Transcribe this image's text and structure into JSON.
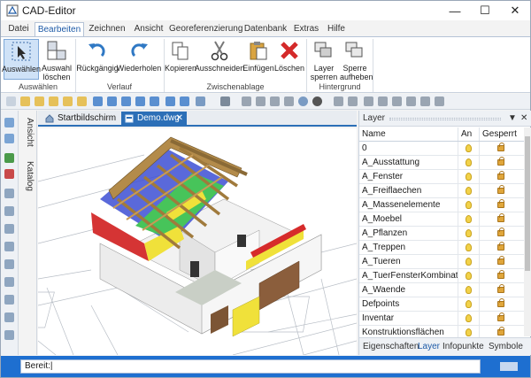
{
  "window": {
    "title": "CAD-Editor",
    "controls": {
      "minimize": "—",
      "maximize": "☐",
      "close": "✕"
    }
  },
  "ribbon_tabs": [
    "Datei",
    "Bearbeiten",
    "Zeichnen",
    "Ansicht",
    "Georeferenzierung",
    "Datenbank",
    "Extras",
    "Hilfe"
  ],
  "active_ribbon_tab": "Bearbeiten",
  "ribbon": {
    "groups": [
      {
        "label": "Auswählen",
        "buttons": [
          {
            "label": "Auswählen",
            "icon": "select-cursor-icon"
          },
          {
            "label": "Auswahl löschen",
            "icon": "clear-selection-icon"
          }
        ]
      },
      {
        "label": "Verlauf",
        "buttons": [
          {
            "label": "Rückgängig",
            "icon": "undo-icon"
          },
          {
            "label": "Wiederholen",
            "icon": "redo-icon"
          }
        ]
      },
      {
        "label": "Zwischenablage",
        "buttons": [
          {
            "label": "Kopieren",
            "icon": "copy-icon"
          },
          {
            "label": "Ausschneiden",
            "icon": "scissors-icon"
          },
          {
            "label": "Einfügen",
            "icon": "paste-icon"
          },
          {
            "label": "Löschen",
            "icon": "delete-icon"
          }
        ]
      },
      {
        "label": "Hintergrund",
        "buttons": [
          {
            "label": "Layer sperren",
            "icon": "layer-lock-icon"
          },
          {
            "label": "Sperre aufheben",
            "icon": "layer-unlock-icon"
          }
        ]
      }
    ]
  },
  "side_tabs": [
    "Ansicht",
    "Katalog"
  ],
  "document_tabs": [
    {
      "label": "Startbildschirm",
      "icon": "home-icon"
    },
    {
      "label": "Demo.dwg",
      "icon": "dwg-file-icon",
      "close": "✕"
    }
  ],
  "layer_panel": {
    "title": "Layer",
    "pin": "▼",
    "close": "✕",
    "columns": [
      "Name",
      "An",
      "Gesperrt"
    ],
    "rows": [
      "0",
      "A_Ausstattung",
      "A_Fenster",
      "A_Freiflaechen",
      "A_Massenelemente",
      "A_Moebel",
      "A_Pflanzen",
      "A_Treppen",
      "A_Tueren",
      "A_TuerFensterKombination",
      "A_Waende",
      "Defpoints",
      "Inventar",
      "Konstruktionsflächen"
    ],
    "bottom_tabs": [
      "Eigenschaften",
      "Layer",
      "Infopunkte",
      "Symbole"
    ],
    "active_bottom_tab": "Layer"
  },
  "command_line": {
    "prompt": "Bereit:"
  },
  "colors": {
    "accent": "#2c6fb7",
    "status_bar": "#1e6fd0",
    "ribbon_selected": "#cfe2f7"
  }
}
